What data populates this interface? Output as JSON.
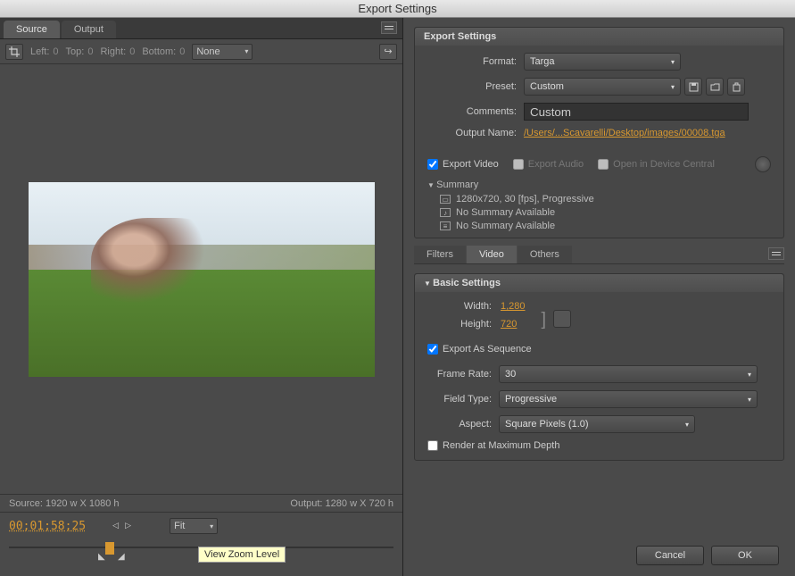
{
  "window": {
    "title": "Export Settings"
  },
  "left_tabs": {
    "source": "Source",
    "output": "Output"
  },
  "crop": {
    "left_label": "Left:",
    "left_val": "0",
    "top_label": "Top:",
    "top_val": "0",
    "right_label": "Right:",
    "right_val": "0",
    "bottom_label": "Bottom:",
    "bottom_val": "0",
    "aspect": "None"
  },
  "sizes": {
    "source": "Source: 1920 w X 1080 h",
    "output": "Output: 1280 w X 720 h"
  },
  "timeline": {
    "timecode": "00;01;58;25",
    "fit": "Fit",
    "tooltip": "View Zoom Level"
  },
  "export": {
    "header": "Export Settings",
    "format_label": "Format:",
    "format_val": "Targa",
    "preset_label": "Preset:",
    "preset_val": "Custom",
    "comments_label": "Comments:",
    "comments_val": "Custom",
    "outputname_label": "Output Name:",
    "outputname_val": "/Users/...Scavarelli/Desktop/images/00008.tga",
    "export_video": "Export Video",
    "export_audio": "Export Audio",
    "open_dc": "Open in Device Central"
  },
  "summary": {
    "title": "Summary",
    "l1": "1280x720, 30 [fps], Progressive",
    "l2": "No Summary Available",
    "l3": "No Summary Available"
  },
  "sub_tabs": {
    "filters": "Filters",
    "video": "Video",
    "others": "Others"
  },
  "basic": {
    "header": "Basic Settings",
    "width_label": "Width:",
    "width_val": "1,280",
    "height_label": "Height:",
    "height_val": "720",
    "export_seq": "Export As Sequence",
    "framerate_label": "Frame Rate:",
    "framerate_val": "30",
    "fieldtype_label": "Field Type:",
    "fieldtype_val": "Progressive",
    "aspect_label": "Aspect:",
    "aspect_val": "Square Pixels (1.0)",
    "render_depth": "Render at Maximum Depth"
  },
  "buttons": {
    "cancel": "Cancel",
    "ok": "OK"
  }
}
